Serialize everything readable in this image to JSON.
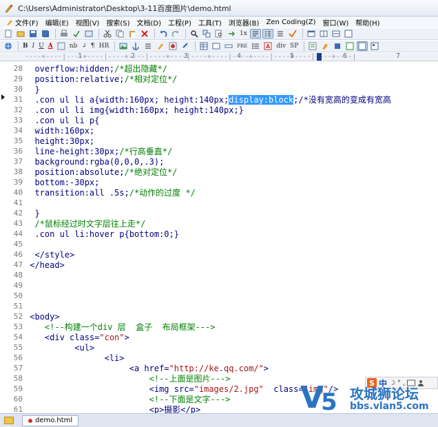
{
  "window": {
    "title": "C:\\Users\\Administrator\\Desktop\\3-11百度图片\\demo.html"
  },
  "menu": [
    {
      "label": "文件(F)"
    },
    {
      "label": "编辑(E)"
    },
    {
      "label": "视图(V)"
    },
    {
      "label": "搜索(S)"
    },
    {
      "label": "文档(D)"
    },
    {
      "label": "工程(P)"
    },
    {
      "label": "工具(T)"
    },
    {
      "label": "浏览器(B)"
    },
    {
      "label": "Zen Coding(Z)"
    },
    {
      "label": "窗口(W)"
    },
    {
      "label": "帮助(H)"
    }
  ],
  "toolbar2": {
    "bold": "B",
    "italic": "I",
    "underline": "U",
    "font_color": "A",
    "nbsp": "nb",
    "div": "div",
    "sp": "SP",
    "para": "¶",
    "hr": "HR"
  },
  "ruler": {
    "marks": [
      "1",
      "2",
      "3",
      "4",
      "5",
      "6",
      "7"
    ]
  },
  "editor": {
    "lines": [
      {
        "n": "28",
        "text": "  overflow:hidden;/*超出隐藏*/"
      },
      {
        "n": "29",
        "text": "  position:relative;/*相对定位*/"
      },
      {
        "n": "30",
        "text": "  }"
      },
      {
        "n": "31",
        "text": "  .con ul li a{width:160px; height:140px;display:block;/*没有宽高的变成有宽高"
      },
      {
        "n": "32",
        "text": "  .con ul li img{width:160px; height:140px;}"
      },
      {
        "n": "33",
        "text": "  .con ul li p{"
      },
      {
        "n": "34",
        "text": "  width:160px;"
      },
      {
        "n": "35",
        "text": "  height:30px;"
      },
      {
        "n": "36",
        "text": "  line-height:30px;/*行高垂直*/"
      },
      {
        "n": "37",
        "text": "  background:rgba(0,0,0,.3);"
      },
      {
        "n": "38",
        "text": "  position:absolute;/*绝对定位*/"
      },
      {
        "n": "39",
        "text": "  bottom:-30px;"
      },
      {
        "n": "40",
        "text": "  transition:all .5s;/*动作的过度 */"
      },
      {
        "n": "41",
        "text": ""
      },
      {
        "n": "42",
        "text": "  }"
      },
      {
        "n": "43",
        "text": "  /*鼠标经过时文字层往上走*/"
      },
      {
        "n": "44",
        "text": "  .con ul li:hover p{bottom:0;}"
      },
      {
        "n": "45",
        "text": ""
      },
      {
        "n": "46",
        "text": "  </style>"
      },
      {
        "n": "47",
        "text": " </head>"
      },
      {
        "n": "48",
        "text": ""
      },
      {
        "n": "49",
        "text": ""
      },
      {
        "n": "50",
        "text": ""
      },
      {
        "n": "51",
        "text": ""
      },
      {
        "n": "52",
        "text": " <body>"
      },
      {
        "n": "53",
        "text": "    <!--构建一个div 层  盒子  布局框架--->"
      },
      {
        "n": "54",
        "text": "    <div class=\"con\">"
      },
      {
        "n": "55",
        "text": "          <ul>"
      },
      {
        "n": "56",
        "text": "                <li>"
      },
      {
        "n": "57",
        "text": "                     <a href=\"http://ke.qq.com/\">"
      },
      {
        "n": "58",
        "text": "                         <!--上面是图片--->"
      },
      {
        "n": "59",
        "text": "                         <img src=\"images/2.jpg\"  class=\"img\"/>"
      },
      {
        "n": "60",
        "text": "                         <!--下面是文字--->"
      },
      {
        "n": "61",
        "text": "                         <p>摄影</p>"
      }
    ],
    "selected_text": "display:block"
  },
  "ime": {
    "logo": "S",
    "mode": "中",
    "glyphs": [
      "☽",
      "°",
      ","
    ]
  },
  "watermark": {
    "brand": "V",
    "brand_digit": "5",
    "title": "攻城狮论坛",
    "url": "bbs.vlan5.com"
  },
  "tabs": [
    {
      "label": "demo.html"
    }
  ]
}
